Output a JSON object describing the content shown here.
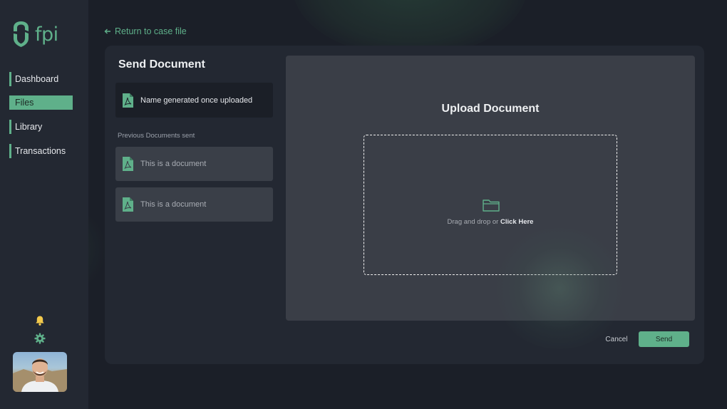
{
  "brand": {
    "name": "fpi",
    "accent": "#5fb08a"
  },
  "sidebar": {
    "nav": [
      {
        "label": "Dashboard",
        "active": false
      },
      {
        "label": "Files",
        "active": true
      },
      {
        "label": "Library",
        "active": false
      },
      {
        "label": "Transactions",
        "active": false
      }
    ],
    "icons": {
      "notifications": "bell-icon",
      "settings": "gear-icon"
    }
  },
  "header": {
    "back_link": "Return to case file"
  },
  "send": {
    "title": "Send Document",
    "current_doc": "Name generated once uploaded",
    "previous_label": "Previous Documents sent",
    "previous_docs": [
      {
        "name": "This is a document"
      },
      {
        "name": "This is a document"
      }
    ]
  },
  "upload": {
    "title": "Upload Document",
    "drop_text": "Drag and drop or ",
    "drop_link": "Click Here"
  },
  "actions": {
    "cancel": "Cancel",
    "send": "Send"
  }
}
